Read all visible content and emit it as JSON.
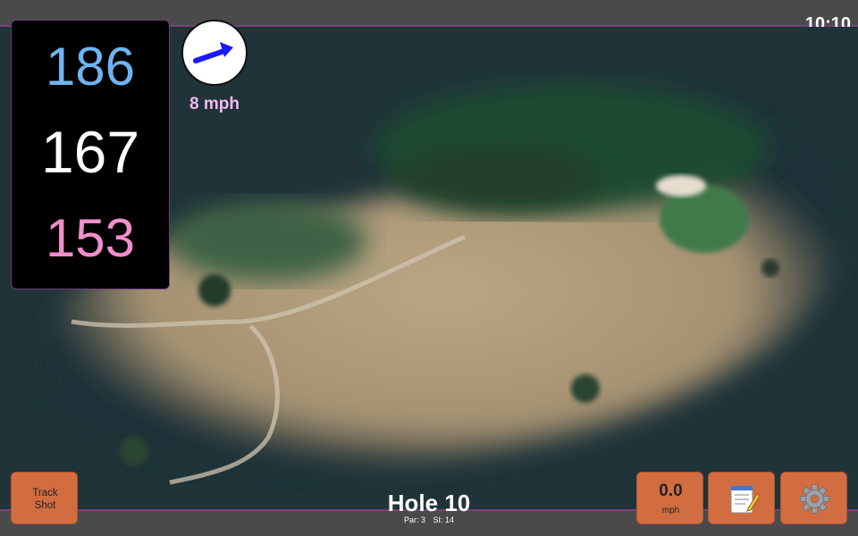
{
  "status_bar": {
    "time": "10:10"
  },
  "distances": {
    "back": "186",
    "center": "167",
    "front": "153",
    "colors": {
      "back": "#6fb4f2",
      "center": "#ffffff",
      "front": "#f28ecb"
    }
  },
  "wind": {
    "speed": "8 mph",
    "icon": "wind-arrow-icon",
    "color": "#f2b8f2"
  },
  "hole": {
    "title": "Hole 10",
    "par": "Par: 3",
    "stroke_index": "SI: 14"
  },
  "buttons": {
    "track_shot_line1": "Track",
    "track_shot_line2": "Shot",
    "speed_value": "0.0",
    "speed_unit": "mph",
    "notes_icon": "notepad-icon",
    "settings_icon": "gear-icon"
  },
  "colors": {
    "button": "#d26d42",
    "bar": "#4a4a4a",
    "accent_line": "#7a3f7a"
  }
}
